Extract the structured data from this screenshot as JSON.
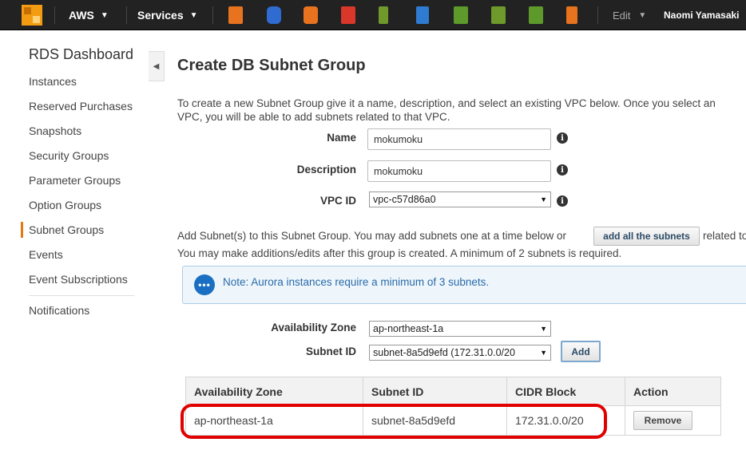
{
  "topbar": {
    "brand": "AWS",
    "services": "Services",
    "edit": "Edit",
    "user": "Naomi Yamasaki",
    "service_icons": [
      {
        "name": "ec2-icon",
        "color": "#e8731f"
      },
      {
        "name": "s3-icon",
        "color": "#2f6bd1"
      },
      {
        "name": "cloudfront-icon",
        "color": "#e8731f"
      },
      {
        "name": "cloudformation-icon",
        "color": "#d9372a"
      },
      {
        "name": "elastic-beanstalk-icon",
        "color": "#6f9a2b"
      },
      {
        "name": "directconnect-icon",
        "color": "#2f7bd1"
      },
      {
        "name": "vpc-icon",
        "color": "#5d9a2b"
      },
      {
        "name": "opsworks-icon",
        "color": "#6f9a2b"
      },
      {
        "name": "workspaces-icon",
        "color": "#5d9a2b"
      },
      {
        "name": "codedeploy-icon",
        "color": "#e8731f"
      }
    ]
  },
  "sidebar": {
    "title": "RDS Dashboard",
    "items": [
      "Instances",
      "Reserved Purchases",
      "Snapshots",
      "Security Groups",
      "Parameter Groups",
      "Option Groups",
      "Subnet Groups",
      "Events",
      "Event Subscriptions",
      "Notifications"
    ],
    "active": "Subnet Groups"
  },
  "main": {
    "title": "Create DB Subnet Group",
    "intro_line1": "To create a new Subnet Group give it a name, description, and select an existing VPC below. Once you select an",
    "intro_line2": "VPC, you will be able to add subnets related to that VPC.",
    "form": {
      "name_label": "Name",
      "name_value": "mokumoku",
      "description_label": "Description",
      "description_value": "mokumoku",
      "vpc_label": "VPC ID",
      "vpc_value": "vpc-c57d86a0"
    },
    "add_line1_a": "Add Subnet(s) to this Subnet Group. You may add subnets one at a time below or",
    "add_all_button": "add all the subnets",
    "add_line1_b": "related to",
    "add_line2": "You may make additions/edits after this group is created. A minimum of 2 subnets is required.",
    "note": "Note: Aurora instances require a minimum of 3 subnets.",
    "az_label": "Availability Zone",
    "az_value": "ap-northeast-1a",
    "subnet_label": "Subnet ID",
    "subnet_value": "subnet-8a5d9efd (172.31.0.0/20",
    "add_button": "Add",
    "table": {
      "headers": [
        "Availability Zone",
        "Subnet ID",
        "CIDR Block",
        "Action"
      ],
      "rows": [
        {
          "az": "ap-northeast-1a",
          "subnet": "subnet-8a5d9efd",
          "cidr": "172.31.0.0/20",
          "action": "Remove"
        }
      ]
    }
  }
}
